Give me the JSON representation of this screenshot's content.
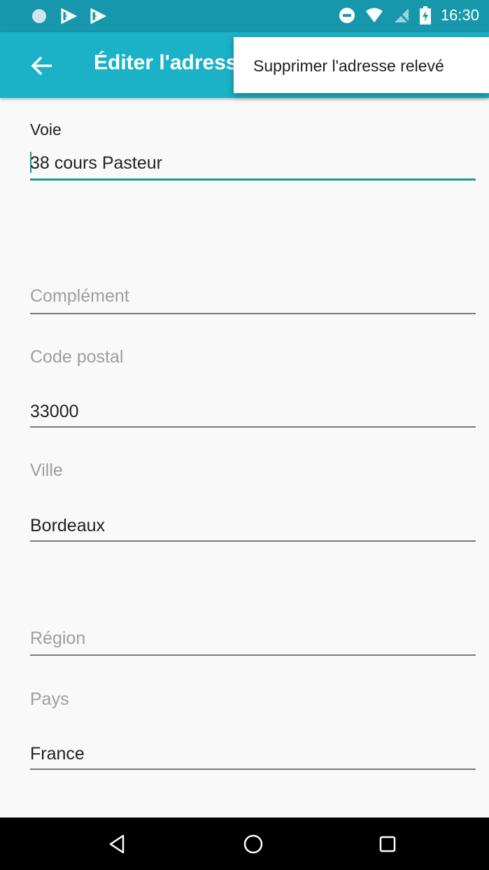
{
  "status_bar": {
    "time": "16:30",
    "left_icons": [
      "circle-icon",
      "play-store-icon",
      "play-store-icon"
    ],
    "right_icons": [
      "do-not-disturb-icon",
      "wifi-icon",
      "no-sim-icon",
      "battery-charging-icon"
    ]
  },
  "app_bar": {
    "title": "Éditer l'adresse",
    "back_icon": "arrow-left-icon"
  },
  "overflow_menu": {
    "items": [
      {
        "label": "Supprimer l'adresse relevé"
      }
    ]
  },
  "form": {
    "voie": {
      "label": "Voie",
      "value": "38 cours Pasteur"
    },
    "complement": {
      "label": "Complément",
      "value": ""
    },
    "code_postal": {
      "label": "Code postal",
      "value": "33000"
    },
    "ville": {
      "label": "Ville",
      "value": "Bordeaux"
    },
    "region": {
      "label": "Région",
      "value": ""
    },
    "pays": {
      "label": "Pays",
      "value": "France"
    }
  },
  "nav_bar": {
    "buttons": [
      "back-triangle-icon",
      "home-circle-icon",
      "recents-square-icon"
    ]
  },
  "colors": {
    "status_bar": "#1797ab",
    "app_bar": "#1bb2c7",
    "accent": "#149a8f",
    "background": "#f9f9f9"
  }
}
